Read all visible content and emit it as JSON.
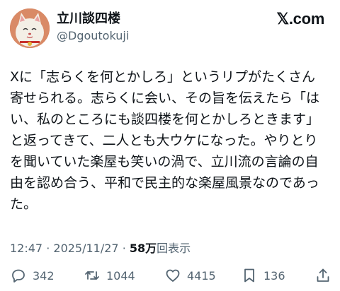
{
  "account": {
    "display_name": "立川談四楼",
    "handle": "@Dgoutokuji",
    "avatar_icon": "maneki-neko-avatar"
  },
  "brand": {
    "label": "𝕏.com"
  },
  "post": {
    "lines": [
      "Xに「志らくを何とかしろ」というリプがたくさん",
      "寄せられる。志らくに会い、その旨を伝えたら「は",
      "い、私のところにも談四楼を何とかしろときます」",
      "と返ってきて、二人とも大ウケになった。やりとり",
      "を聞いていた楽屋も笑いの渦で、立川流の言論の自",
      "由を認め合う、平和で民主的な楽屋風景なのであっ",
      "た。"
    ]
  },
  "meta": {
    "time": "12:47",
    "separator": "·",
    "date": "2025/11/27",
    "views_count": "58万",
    "views_label": "回表示"
  },
  "actions": {
    "reply_count": "342",
    "repost_count": "1044",
    "like_count": "4415",
    "bookmark_count": "136",
    "icons": [
      "reply-icon",
      "repost-icon",
      "like-icon",
      "bookmark-icon",
      "share-icon"
    ]
  },
  "colors": {
    "text": "#0f1419",
    "secondary": "#536471",
    "background": "#ffffff"
  }
}
